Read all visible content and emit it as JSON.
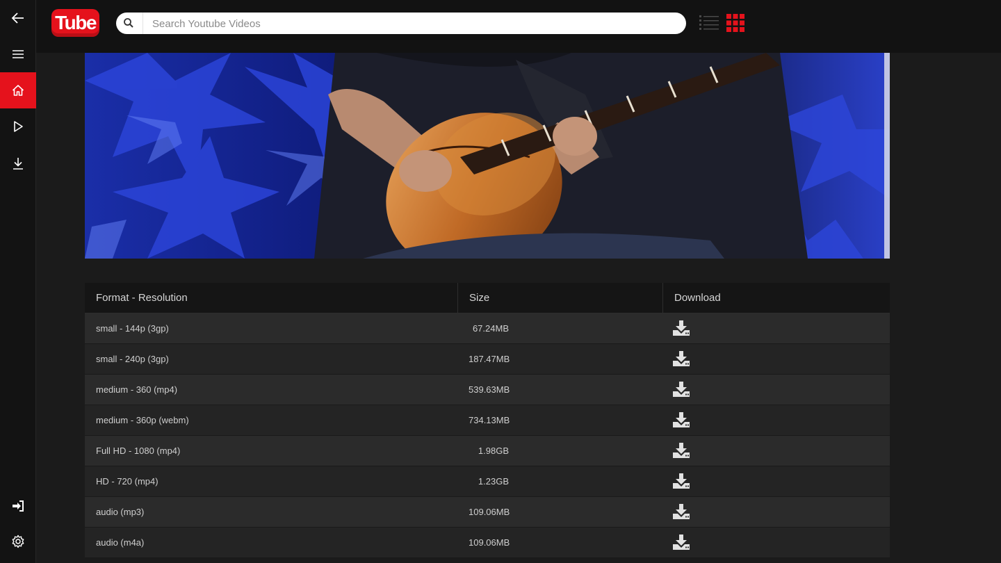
{
  "app": {
    "logo_text": "Tube"
  },
  "sidebar": {
    "items": [
      {
        "name": "back",
        "icon": "arrow-left-icon"
      },
      {
        "name": "menu",
        "icon": "hamburger-menu-icon"
      },
      {
        "name": "home",
        "icon": "home-icon",
        "active": true
      },
      {
        "name": "play",
        "icon": "play-icon"
      },
      {
        "name": "downloads",
        "icon": "download-icon"
      },
      {
        "name": "sign-in",
        "icon": "sign-in-icon"
      },
      {
        "name": "settings",
        "icon": "gear-icon"
      }
    ],
    "active_color": "#e5121c"
  },
  "search": {
    "placeholder": "Search Youtube Videos",
    "value": ""
  },
  "view_toggle": {
    "list_icon": "list-view-icon",
    "grid_icon": "grid-view-icon",
    "active": "grid"
  },
  "table": {
    "headers": {
      "format": "Format - Resolution",
      "size": "Size",
      "download": "Download"
    },
    "rows": [
      {
        "format": "small - 144p (3gp)",
        "size": "67.24MB"
      },
      {
        "format": "small - 240p (3gp)",
        "size": "187.47MB"
      },
      {
        "format": "medium - 360 (mp4)",
        "size": "539.63MB"
      },
      {
        "format": "medium - 360p (webm)",
        "size": "734.13MB"
      },
      {
        "format": "Full HD - 1080 (mp4)",
        "size": "1.98GB"
      },
      {
        "format": "HD - 720 (mp4)",
        "size": "1.23GB"
      },
      {
        "format": "audio (mp3)",
        "size": "109.06MB"
      },
      {
        "format": "audio (m4a)",
        "size": "109.06MB"
      }
    ]
  },
  "colors": {
    "accent": "#e5121c",
    "background": "#1b1b1b",
    "topbar": "#121212"
  }
}
